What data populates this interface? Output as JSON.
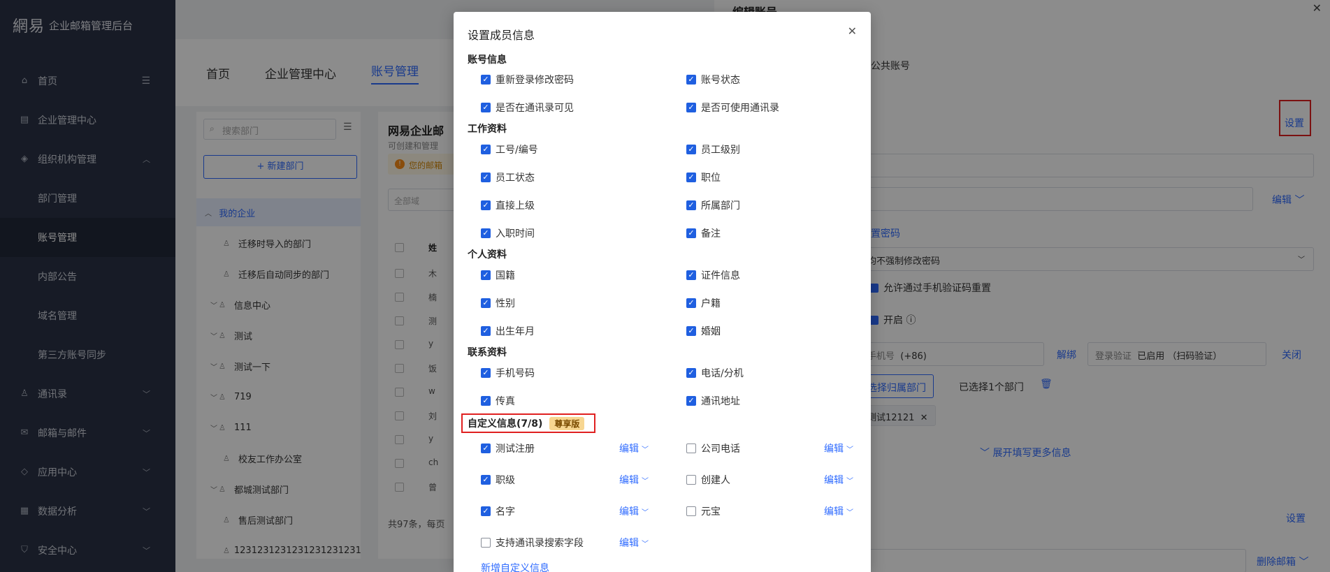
{
  "sidebar": {
    "logo_mark": "網易",
    "logo_text": "企业邮箱管理后台",
    "items": [
      {
        "label": "首页",
        "icon": "home-icon"
      },
      {
        "label": "企业管理中心",
        "icon": "building-icon"
      },
      {
        "label": "组织机构管理",
        "icon": "org-icon"
      },
      {
        "label": "通讯录",
        "icon": "contacts-icon"
      },
      {
        "label": "邮箱与邮件",
        "icon": "mail-icon"
      },
      {
        "label": "应用中心",
        "icon": "apps-icon"
      },
      {
        "label": "数据分析",
        "icon": "chart-icon"
      },
      {
        "label": "安全中心",
        "icon": "shield-icon"
      }
    ],
    "subitems": [
      "部门管理",
      "账号管理",
      "内部公告",
      "域名管理",
      "第三方账号同步"
    ]
  },
  "main": {
    "tabs": [
      "首页",
      "企业管理中心",
      "账号管理"
    ],
    "search_placeholder": "搜索部门",
    "new_dept_label": "+ 新建部门",
    "tree": [
      "我的企业",
      "迁移时导入的部门",
      "迁移后自动同步的部门",
      "信息中心",
      "测试",
      "测试一下",
      "719",
      "111",
      "校友工作办公室",
      "都城测试部门",
      "售后测试部门",
      "1231231231231231231231"
    ],
    "list_title": "网易企业邮",
    "list_desc": "可创建和管理",
    "warn_text": "您的邮箱",
    "all_domain": "全部域",
    "rows": [
      "姓",
      "木",
      "楠",
      "测",
      "y",
      "饭",
      "w",
      "刘",
      "y",
      "ch",
      "曾"
    ],
    "footer": "共97条，每页"
  },
  "drawer": {
    "title": "编辑账号",
    "public_account": "公共账号",
    "settings_link": "设置",
    "edit_link": "编辑",
    "reset_password": "置密码",
    "password_policy": "均不强制修改密码",
    "sms_reset": "允许通过手机验证码重置",
    "enable": "开启",
    "phone_label": "手机号",
    "phone_prefix": "(+86)",
    "unbind": "解绑",
    "login_verify": "登录验证",
    "login_status": "已启用 （扫码验证）",
    "close": "关闭",
    "select_dept": "选择归属部门",
    "selected_count": "已选择1个部门",
    "dept_tag": "测试12121",
    "expand_more": "展开填写更多信息",
    "settings_link2": "设置",
    "delete_mailbox": "删除邮箱"
  },
  "modal": {
    "title": "设置成员信息",
    "sections": {
      "account": "账号信息",
      "work": "工作资料",
      "personal": "个人资料",
      "contact": "联系资料",
      "custom": "自定义信息(7/8)"
    },
    "vip_badge": "尊享版",
    "account_items": [
      {
        "label": "重新登录修改密码",
        "checked": true
      },
      {
        "label": "账号状态",
        "checked": true
      },
      {
        "label": "是否在通讯录可见",
        "checked": true
      },
      {
        "label": "是否可使用通讯录",
        "checked": true
      }
    ],
    "work_items": [
      {
        "label": "工号/编号",
        "checked": true
      },
      {
        "label": "员工级别",
        "checked": true
      },
      {
        "label": "员工状态",
        "checked": true
      },
      {
        "label": "职位",
        "checked": true
      },
      {
        "label": "直接上级",
        "checked": true
      },
      {
        "label": "所属部门",
        "checked": true
      },
      {
        "label": "入职时间",
        "checked": true
      },
      {
        "label": "备注",
        "checked": true
      }
    ],
    "personal_items": [
      {
        "label": "国籍",
        "checked": true
      },
      {
        "label": "证件信息",
        "checked": true
      },
      {
        "label": "性别",
        "checked": true
      },
      {
        "label": "户籍",
        "checked": true
      },
      {
        "label": "出生年月",
        "checked": true
      },
      {
        "label": "婚姻",
        "checked": true
      }
    ],
    "contact_items": [
      {
        "label": "手机号码",
        "checked": true
      },
      {
        "label": "电话/分机",
        "checked": true
      },
      {
        "label": "传真",
        "checked": true
      },
      {
        "label": "通讯地址",
        "checked": true
      }
    ],
    "custom_items": [
      {
        "label": "测试注册",
        "checked": true
      },
      {
        "label": "公司电话",
        "checked": false
      },
      {
        "label": "职级",
        "checked": true
      },
      {
        "label": "创建人",
        "checked": false
      },
      {
        "label": "名字",
        "checked": true
      },
      {
        "label": "元宝",
        "checked": false
      },
      {
        "label": "支持通讯录搜索字段",
        "checked": false
      }
    ],
    "edit_label": "编辑",
    "add_custom": "新增自定义信息"
  }
}
